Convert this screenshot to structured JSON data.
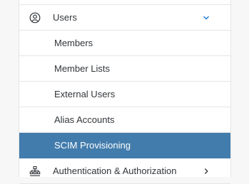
{
  "nav": {
    "group_users": {
      "label": "Users",
      "icon": "user-circle-icon",
      "expanded": true
    },
    "subitems": [
      {
        "label": "Members"
      },
      {
        "label": "Member Lists"
      },
      {
        "label": "External Users"
      },
      {
        "label": "Alias Accounts"
      },
      {
        "label": "SCIM Provisioning",
        "selected": true
      }
    ],
    "group_auth": {
      "label": "Authentication & Authorization",
      "icon": "org-hierarchy-icon",
      "expanded": false
    }
  },
  "colors": {
    "selected_bg": "#427cac",
    "text": "#32363a",
    "icon": "#0a6ed1",
    "border": "#e5e5e5"
  }
}
